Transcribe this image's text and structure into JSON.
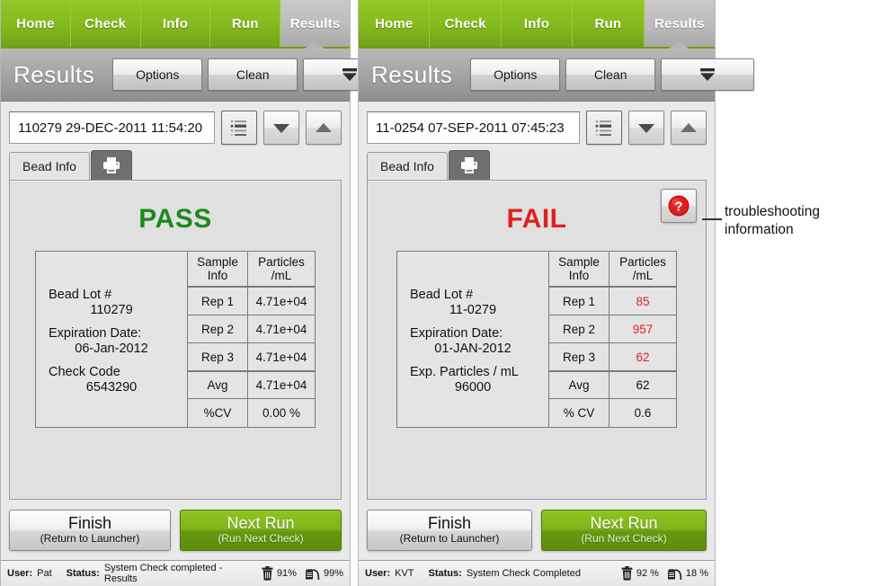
{
  "annotation": {
    "text": "troubleshooting information"
  },
  "panels": [
    {
      "id": "left",
      "tabs": [
        {
          "label": "Home",
          "active": false
        },
        {
          "label": "Check",
          "active": false
        },
        {
          "label": "Info",
          "active": false
        },
        {
          "label": "Run",
          "active": false
        },
        {
          "label": "Results",
          "active": true
        }
      ],
      "header": {
        "title": "Results",
        "options_label": "Options",
        "clean_label": "Clean",
        "more_icon": "collapse-down-icon"
      },
      "selector": {
        "value": "110279 29-DEC-2011 11:54:20",
        "list_icon": "list-view-icon",
        "down_icon": "chevron-down-icon",
        "up_icon": "chevron-up-icon"
      },
      "card": {
        "tab_label": "Bead Info",
        "print_icon": "printer-icon",
        "verdict": "PASS",
        "verdict_color": "#1b8a1b",
        "has_help": false,
        "info": [
          {
            "label": "Bead Lot #",
            "value": "110279"
          },
          {
            "label": "Expiration Date:",
            "value": "06-Jan-2012"
          },
          {
            "label": "Check Code",
            "value": "6543290"
          }
        ],
        "table": {
          "headers": [
            "Sample Info",
            "Particles /mL"
          ],
          "header_lines": [
            [
              "Sample",
              "Info"
            ],
            [
              "Particles",
              "/mL"
            ]
          ],
          "rows": [
            {
              "name": "Rep 1",
              "value": "4.71e+04",
              "flagged": false
            },
            {
              "name": "Rep 2",
              "value": "4.71e+04",
              "flagged": false
            },
            {
              "name": "Rep 3",
              "value": "4.71e+04",
              "flagged": false
            },
            {
              "name": "Avg",
              "value": "4.71e+04",
              "flagged": false
            },
            {
              "name": "%CV",
              "value": "0.00 %",
              "flagged": false
            }
          ]
        }
      },
      "actions": {
        "finish_title": "Finish",
        "finish_sub": "(Return to Launcher)",
        "next_title": "Next Run",
        "next_sub": "(Run Next Check)"
      },
      "status": {
        "user_key": "User:",
        "user_value": "Pat",
        "status_key": "Status:",
        "status_value": "System Check completed - Results",
        "waste_icon": "trash-bin-icon",
        "waste_value": "91%",
        "sheath_icon": "sheath-fluid-icon",
        "sheath_value": "99%"
      }
    },
    {
      "id": "right",
      "tabs": [
        {
          "label": "Home",
          "active": false
        },
        {
          "label": "Check",
          "active": false
        },
        {
          "label": "Info",
          "active": false
        },
        {
          "label": "Run",
          "active": false
        },
        {
          "label": "Results",
          "active": true
        }
      ],
      "header": {
        "title": "Results",
        "options_label": "Options",
        "clean_label": "Clean",
        "more_icon": "collapse-down-icon"
      },
      "selector": {
        "value": "11-0254 07-SEP-2011 07:45:23",
        "list_icon": "list-view-icon",
        "down_icon": "chevron-down-icon",
        "up_icon": "chevron-up-icon"
      },
      "card": {
        "tab_label": "Bead Info",
        "print_icon": "printer-icon",
        "verdict": "FAIL",
        "verdict_color": "#e01f1f",
        "has_help": true,
        "help_icon": "help-question-icon",
        "info": [
          {
            "label": "Bead Lot #",
            "value": "11-0279"
          },
          {
            "label": "Expiration Date:",
            "value": "01-JAN-2012"
          },
          {
            "label": "Exp. Particles / mL",
            "value": "96000"
          }
        ],
        "table": {
          "headers": [
            "Sample Info",
            "Particles /mL"
          ],
          "header_lines": [
            [
              "Sample",
              "Info"
            ],
            [
              "Particles",
              "/mL"
            ]
          ],
          "rows": [
            {
              "name": "Rep 1",
              "value": "85",
              "flagged": true
            },
            {
              "name": "Rep 2",
              "value": "957",
              "flagged": true
            },
            {
              "name": "Rep 3",
              "value": "62",
              "flagged": true
            },
            {
              "name": "Avg",
              "value": "62",
              "flagged": false
            },
            {
              "name": "% CV",
              "value": "0.6",
              "flagged": false
            }
          ]
        }
      },
      "actions": {
        "finish_title": "Finish",
        "finish_sub": "(Return to Launcher)",
        "next_title": "Next Run",
        "next_sub": "(Run Next Check)"
      },
      "status": {
        "user_key": "User:",
        "user_value": "KVT",
        "status_key": "Status:",
        "status_value": "System Check Completed",
        "waste_icon": "trash-bin-icon",
        "waste_value": "92 %",
        "sheath_icon": "sheath-fluid-icon",
        "sheath_value": "18 %"
      }
    }
  ]
}
